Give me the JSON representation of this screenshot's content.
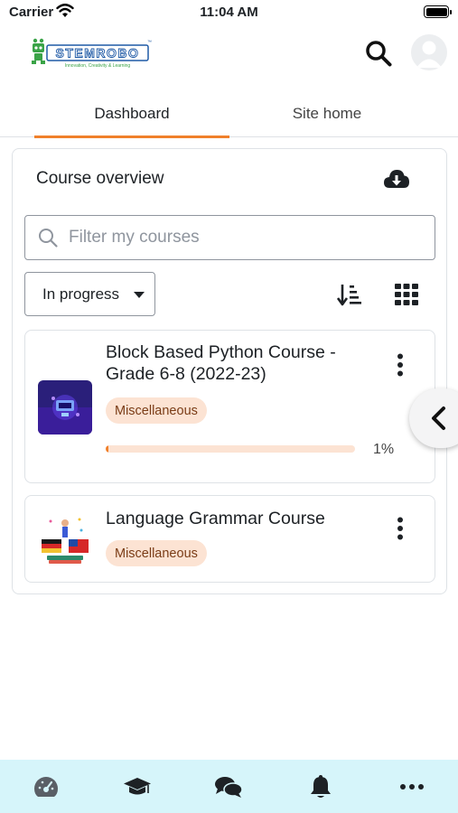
{
  "status_bar": {
    "carrier": "Carrier",
    "time": "11:04 AM"
  },
  "header": {
    "logo_text": "STEMROBO",
    "logo_tagline": "Innovation, Creativity & Learning",
    "icons": [
      "search-icon",
      "user-avatar"
    ]
  },
  "tabs": [
    {
      "label": "Dashboard",
      "active": true
    },
    {
      "label": "Site home",
      "active": false
    }
  ],
  "course_overview": {
    "title": "Course overview",
    "download_icon": "cloud-download-icon",
    "search_placeholder": "Filter my courses",
    "filter_selected": "In progress",
    "sort_icon": "sort-icon",
    "view_icon": "grid-view-icon",
    "courses": [
      {
        "title": "Block Based Python Course - Grade 6-8 (2022-23)",
        "category": "Miscellaneous",
        "progress_percent": 1,
        "progress_label": "1%"
      },
      {
        "title": "Language Grammar Course",
        "category": "Miscellaneous"
      }
    ]
  },
  "bottom_nav": {
    "items": [
      "dashboard-gauge-icon",
      "graduation-cap-icon",
      "chat-bubbles-icon",
      "bell-icon",
      "more-icon"
    ]
  },
  "colors": {
    "accent": "#f0802b",
    "badge_bg": "#fce3d3",
    "badge_text": "#7a3c16",
    "bottom_bar_bg": "#d6f5fa",
    "logo_green": "#3aa347",
    "logo_blue": "#1f5aa6"
  }
}
